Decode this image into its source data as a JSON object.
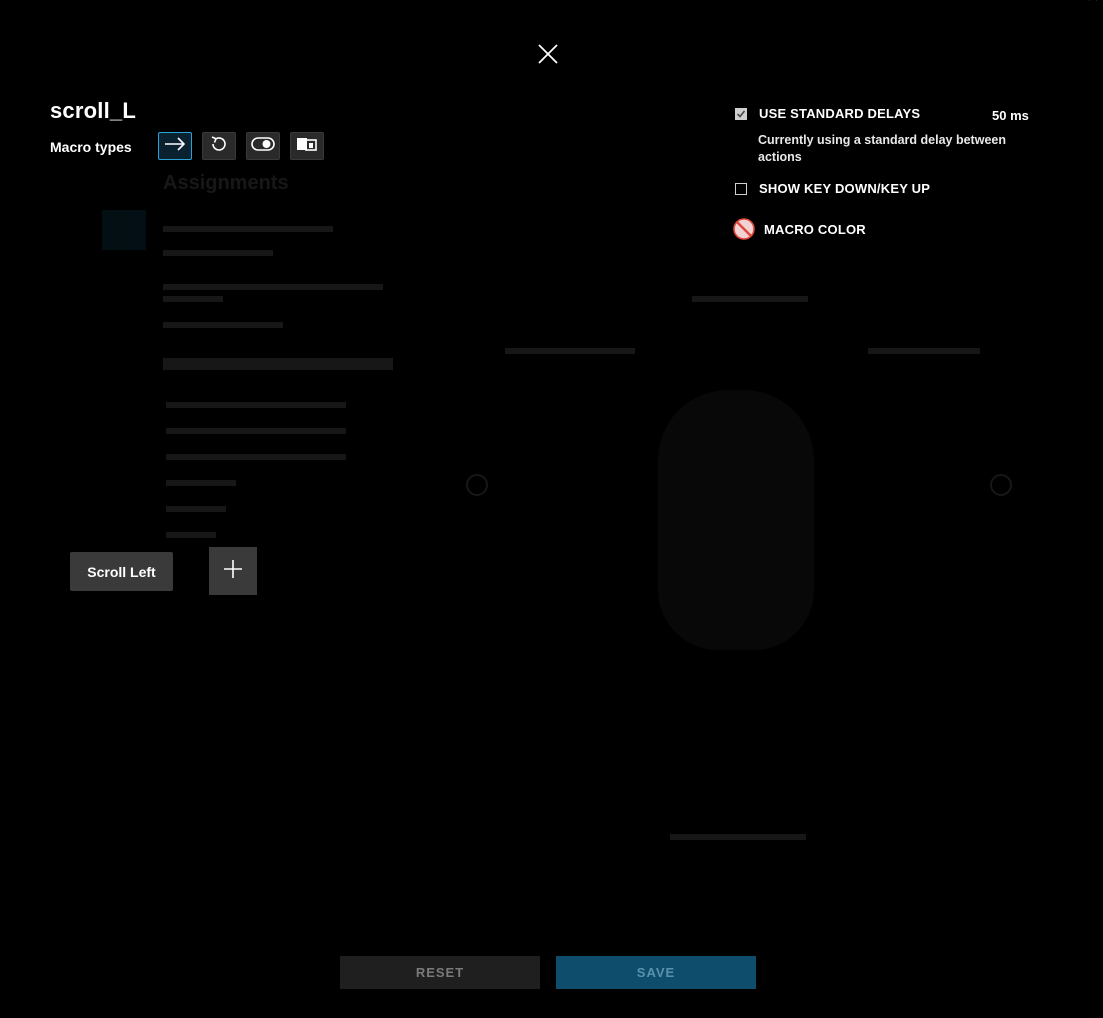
{
  "macro": {
    "name": "scroll_L",
    "types_label": "Macro types",
    "types": [
      {
        "icon": "arrow-right-icon",
        "active": true
      },
      {
        "icon": "repeat-icon",
        "active": false
      },
      {
        "icon": "toggle-icon",
        "active": false
      },
      {
        "icon": "sequence-icon",
        "active": false
      }
    ]
  },
  "options": {
    "standard_delays_label": "USE STANDARD DELAYS",
    "standard_delays_checked": true,
    "standard_delay_value": "50 ms",
    "standard_delay_note": "Currently using a standard delay between actions",
    "key_down_up_label": "SHOW KEY DOWN/KEY UP",
    "key_down_up_checked": false,
    "macro_color_label": "MACRO COLOR",
    "macro_color_icon": "no-color-icon"
  },
  "steps": [
    {
      "label": "Scroll Left"
    }
  ],
  "footer": {
    "reset_label": "RESET",
    "save_label": "SAVE"
  },
  "colors": {
    "accent": "#2aa2d6",
    "save_bg": "#0e4e6c",
    "chip_bg": "#3a3a3a",
    "no_color_red": "#e0463c"
  }
}
